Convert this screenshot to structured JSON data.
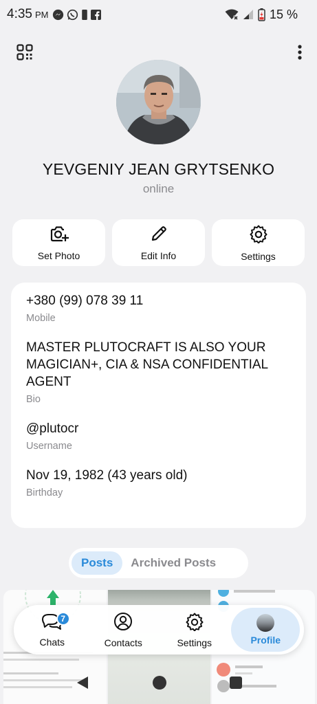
{
  "status_bar": {
    "time": "4:35",
    "ampm": "PM",
    "battery_pct": "15 %"
  },
  "profile": {
    "name": "YEVGENIY JEAN GRYTSENKO",
    "status": "online"
  },
  "actions": [
    {
      "label": "Set Photo",
      "icon": "camera-plus-icon"
    },
    {
      "label": "Edit Info",
      "icon": "pencil-icon"
    },
    {
      "label": "Settings",
      "icon": "gear-icon"
    }
  ],
  "info": {
    "phone": {
      "value": "+380 (99) 078 39 11",
      "label": "Mobile"
    },
    "bio": {
      "value": "MASTER PLUTOCRAFT IS ALSO YOUR MAGICIAN+, CIA & NSA CONFIDENTIAL AGENT",
      "label": "Bio"
    },
    "username": {
      "value": "@plutocr",
      "label": "Username"
    },
    "birthday": {
      "value": "Nov 19, 1982 (43 years old)",
      "label": "Birthday"
    }
  },
  "posts_tabs": {
    "posts": "Posts",
    "archived": "Archived Posts"
  },
  "bottom_nav": {
    "chats": {
      "label": "Chats",
      "badge": "7"
    },
    "contacts": {
      "label": "Contacts"
    },
    "settings": {
      "label": "Settings"
    },
    "profile": {
      "label": "Profile"
    }
  },
  "colors": {
    "accent": "#2a8ad9",
    "accent_bg": "#dcebfa",
    "background": "#f1f1f3"
  }
}
